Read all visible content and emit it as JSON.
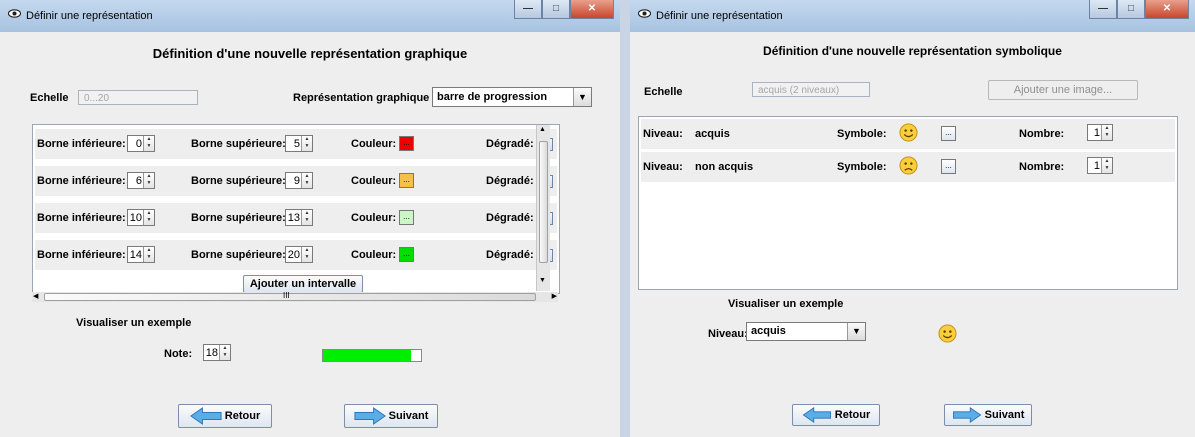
{
  "left": {
    "window_title": "Définir une représentation",
    "heading": "Définition d'une nouvelle représentation graphique",
    "scale_label": "Echelle",
    "scale_value": "0...20",
    "representation_label": "Représentation graphique",
    "representation_value": "barre de progression",
    "labels": {
      "lower": "Borne inférieure:",
      "upper": "Borne supérieure:",
      "color": "Couleur:",
      "gradient": "Dégradé:"
    },
    "intervals": [
      {
        "lower": "0",
        "upper": "5",
        "color": "#ee0000",
        "swatch_text": "..."
      },
      {
        "lower": "6",
        "upper": "9",
        "color": "#f5c04a",
        "swatch_text": "..."
      },
      {
        "lower": "10",
        "upper": "13",
        "color": "#ccf5c8",
        "swatch_text": "..."
      },
      {
        "lower": "14",
        "upper": "20",
        "color": "#00dd00",
        "swatch_text": "..."
      }
    ],
    "add_interval_label": "Ajouter un intervalle",
    "scroll_grip": "III",
    "example_heading": "Visualiser un exemple",
    "note_label": "Note:",
    "note_value": "18",
    "example_progress": 0.9,
    "progress_color": "#00ee00",
    "back_label": "Retour",
    "next_label": "Suivant"
  },
  "right": {
    "window_title": "Définir une représentation",
    "heading": "Définition d'une nouvelle représentation symbolique",
    "scale_label": "Echelle",
    "scale_value": "acquis (2 niveaux)",
    "add_image_label": "Ajouter une image...",
    "labels": {
      "level": "Niveau:",
      "symbol": "Symbole:",
      "count": "Nombre:"
    },
    "levels": [
      {
        "name": "acquis",
        "symbol": "smiley-happy-icon",
        "browse": "...",
        "count": "1"
      },
      {
        "name": "non acquis",
        "symbol": "smiley-sad-icon",
        "browse": "...",
        "count": "1"
      }
    ],
    "example_heading": "Visualiser un exemple",
    "example_level_label": "Niveau:",
    "example_level_value": "acquis",
    "back_label": "Retour",
    "next_label": "Suivant"
  },
  "colors": {
    "arrow_blue": "#5aaee8",
    "titlebar": "#b5cde8"
  }
}
